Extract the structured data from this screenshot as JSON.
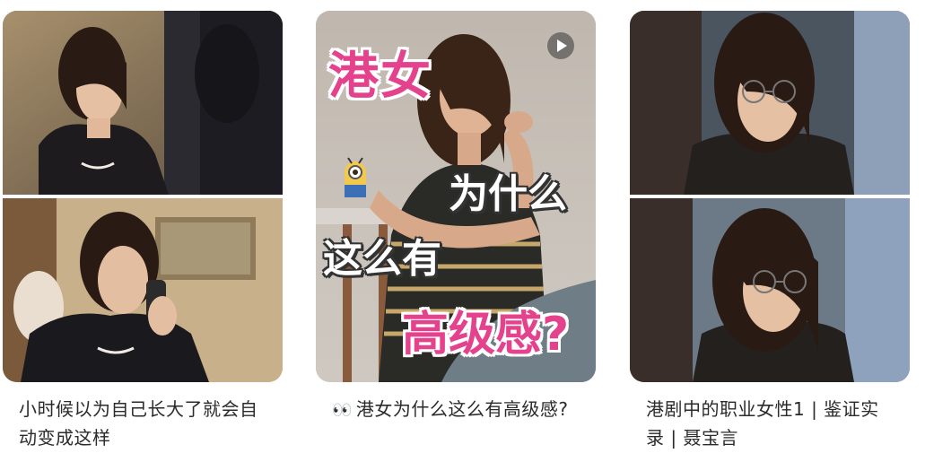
{
  "feed": {
    "cards": [
      {
        "caption": "小时候以为自己长大了就会自动变成这样",
        "cover_icon": "drama-still-photo"
      },
      {
        "caption_emoji": "👀",
        "caption": "港女为什么这么有高级感?",
        "has_video": true,
        "play_icon": "play-icon",
        "overlay": {
          "line1": "港女",
          "line2": "为什么",
          "line3": "这么有",
          "line4": "高级感?"
        }
      },
      {
        "caption": "港剧中的职业女性1 | 鉴证实录 | 聂宝言",
        "cover_icon": "drama-still-photo"
      }
    ]
  },
  "colors": {
    "overlay_pink": "#e4428d",
    "caption_text": "#2b2b2b",
    "card_radius_bg": "#cfc6bd"
  }
}
